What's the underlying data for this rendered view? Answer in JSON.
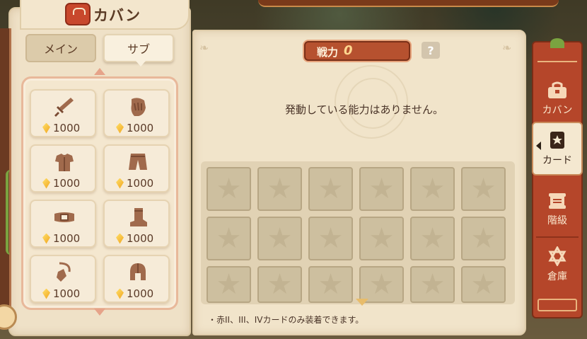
{
  "window": {
    "title": "カバン"
  },
  "tabs": [
    {
      "label": "メイン",
      "selected": true
    },
    {
      "label": "サブ",
      "selected": false
    }
  ],
  "equipment": [
    {
      "icon": "sword-icon",
      "price": "1000"
    },
    {
      "icon": "glove-icon",
      "price": "1000"
    },
    {
      "icon": "armor-icon",
      "price": "1000"
    },
    {
      "icon": "pants-icon",
      "price": "1000"
    },
    {
      "icon": "belt-icon",
      "price": "1000"
    },
    {
      "icon": "boots-icon",
      "price": "1000"
    },
    {
      "icon": "necklace-icon",
      "price": "1000"
    },
    {
      "icon": "helmet-icon",
      "price": "1000"
    }
  ],
  "power": {
    "label": "戦力",
    "value": "0"
  },
  "help": {
    "label": "?"
  },
  "status": {
    "no_ability": "発動している能力はありません。"
  },
  "card_slots": {
    "rows_visible": 3,
    "columns": 6,
    "state": "empty"
  },
  "note": "・赤II、III、IVカードのみ装着できます。",
  "side_nav": [
    {
      "label": "カバン",
      "icon": "bag-icon",
      "active": false
    },
    {
      "label": "カード",
      "icon": "card-icon",
      "active": true
    },
    {
      "label": "階級",
      "icon": "scroll-icon",
      "active": false
    },
    {
      "label": "倉庫",
      "icon": "star-icon",
      "active": false
    }
  ],
  "colors": {
    "accent_red": "#b5462a",
    "parchment": "#f1e4ca",
    "gold": "#f0a31c",
    "text_dark": "#4a3428"
  }
}
